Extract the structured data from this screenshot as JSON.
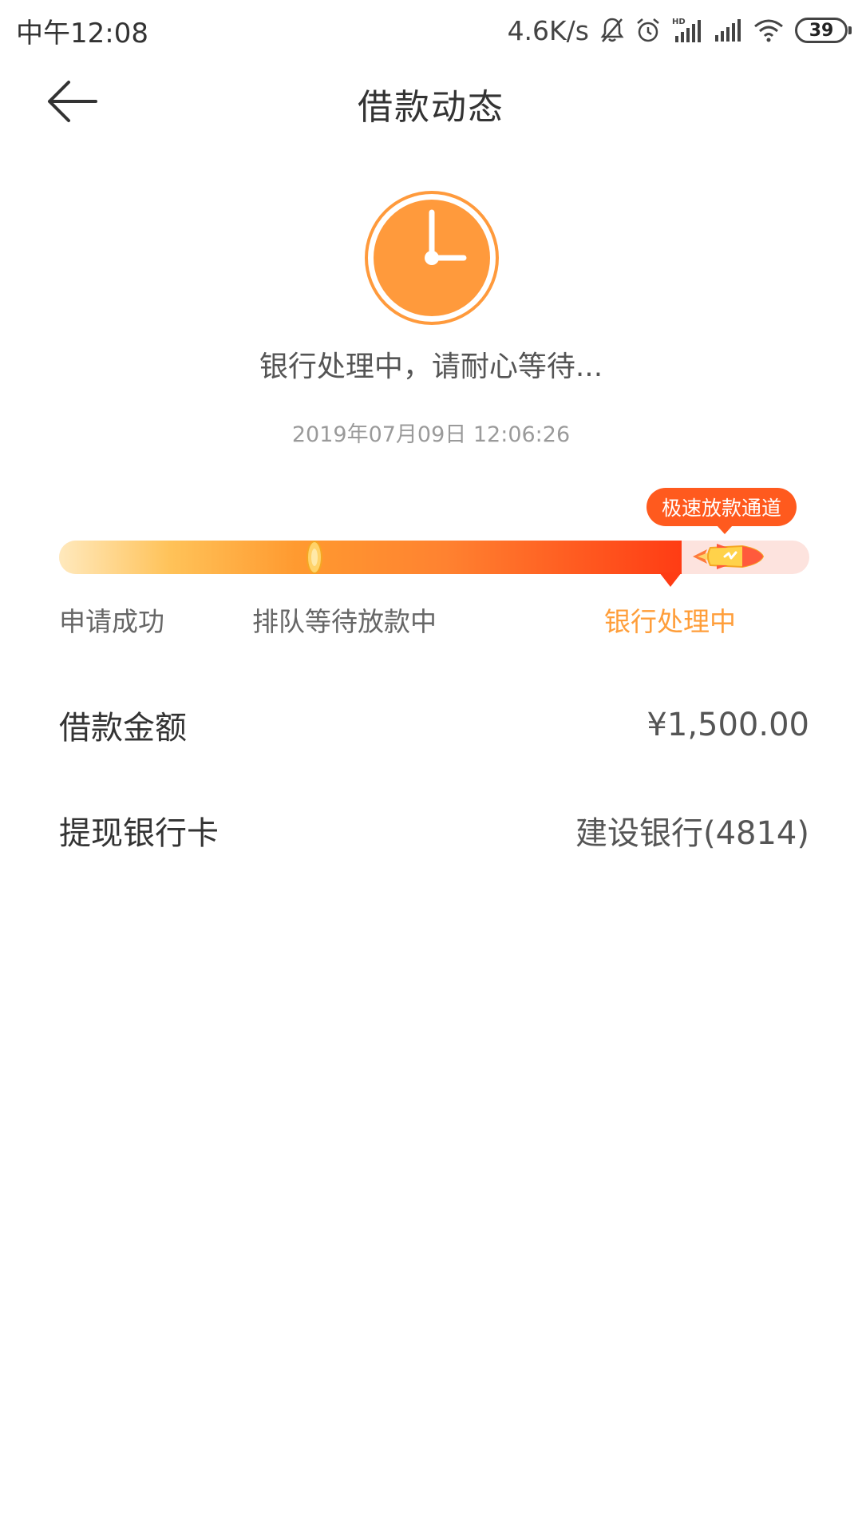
{
  "status_bar": {
    "time": "中午12:08",
    "net_speed": "4.6K/s",
    "battery": "39",
    "icons": [
      "bell-muted-icon",
      "alarm-icon",
      "hd-signal-icon",
      "signal-icon",
      "wifi-icon",
      "battery-icon"
    ]
  },
  "nav": {
    "title": "借款动态",
    "back_icon": "arrow-left-icon"
  },
  "hero": {
    "icon": "clock-icon",
    "accent_color": "#ff9a3c",
    "message": "银行处理中，请耐心等待...",
    "timestamp": "2019年07月09日 12:06:26"
  },
  "progress": {
    "badge": "极速放款通道",
    "steps": [
      {
        "label": "申请成功",
        "state": "done"
      },
      {
        "label": "排队等待放款中",
        "state": "done"
      },
      {
        "label": "银行处理中",
        "state": "current"
      }
    ],
    "fill_fraction": 0.83,
    "coin_fraction": 0.34,
    "active_color": "#ff9e3a"
  },
  "details": {
    "amount_label": "借款金额",
    "amount_value": "¥1,500.00",
    "card_label": "提现银行卡",
    "card_value": "建设银行(4814)"
  }
}
